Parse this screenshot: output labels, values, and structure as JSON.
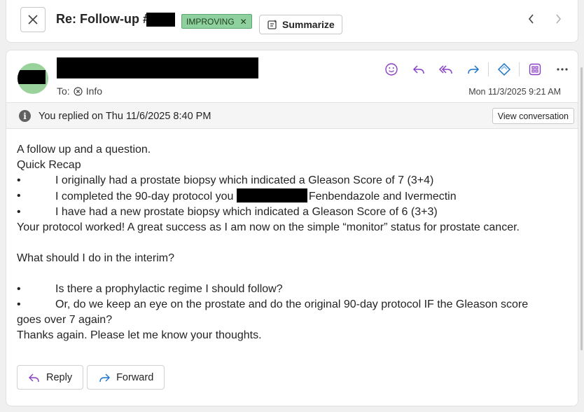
{
  "header": {
    "subject_prefix": "Re: Follow-up #",
    "tag_label": "IMPROVING",
    "summarize_label": "Summarize"
  },
  "message": {
    "to_label": "To:",
    "recipient": "Info",
    "date": "Mon 11/3/2025 9:21 AM",
    "notice": "You replied on Thu 11/6/2025 8:40 PM",
    "view_conversation": "View conversation",
    "body": {
      "l1": "A follow up and a question.",
      "l2": "Quick Recap",
      "b1": "I originally had a prostate biopsy which indicated a Gleason Score of 7 (3+4)",
      "b2_pre": "I completed the 90-day protocol you ",
      "b2_post": "Fenbendazole and Ivermectin",
      "b3": "I have had a new prostate biopsy which indicated a Gleason Score of 6 (3+3)",
      "l3": "Your protocol worked! A great success as I am now on the simple “monitor” status for prostate cancer.",
      "l4": "What should I do in the interim?",
      "b4": "Is there a prophylactic regime I should follow?",
      "b5_a": "Or, do we keep an eye on the prostate and do the original 90-day protocol IF the Gleason score",
      "b5_b": "goes over 7 again?",
      "l5": "Thanks again.  Please let me know your thoughts.",
      "bullet_char": "•"
    },
    "reply_label": "Reply",
    "forward_label": "Forward"
  },
  "colors": {
    "accent": "#7a4fd6",
    "action_blue": "#1a73c8",
    "tag_green": "#8fd19e"
  },
  "icons": [
    "close-icon",
    "summarize-icon",
    "chevron-left-icon",
    "chevron-right-icon",
    "emoji-icon",
    "reply-icon",
    "reply-all-icon",
    "forward-icon",
    "copilot-icon",
    "apps-icon",
    "more-icon",
    "remove-recipient-icon",
    "info-icon"
  ]
}
